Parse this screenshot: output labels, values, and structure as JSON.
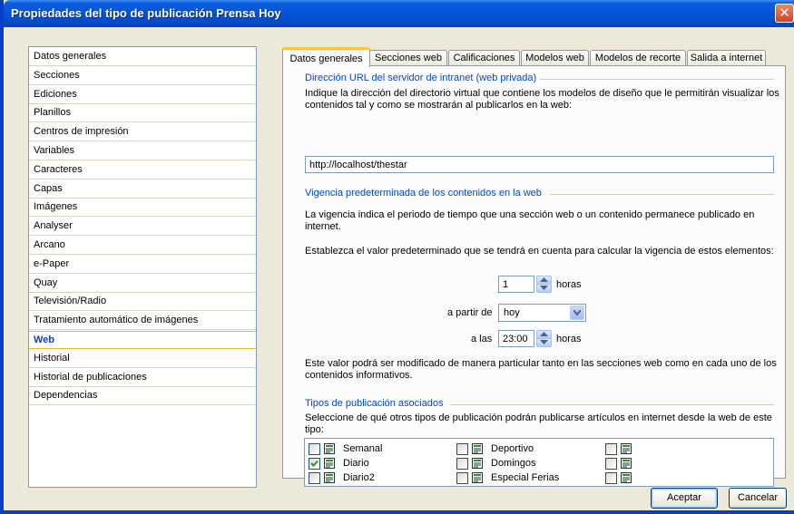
{
  "window": {
    "title": "Propiedades del tipo de publicación Prensa Hoy"
  },
  "icons": {
    "close": "close-icon",
    "spin_up": "arrow-up-icon",
    "spin_down": "arrow-down-icon",
    "dropdown": "chevron-down-icon",
    "checkmark": "checkmark-icon",
    "publication": "newspaper-icon"
  },
  "sidebar": {
    "items": [
      "Datos generales",
      "Secciones",
      "Ediciones",
      "Planillos",
      "Centros de impresión",
      "Variables",
      "Caracteres",
      "Capas",
      "Imágenes",
      "Analyser",
      "Arcano",
      "e-Paper",
      "Quay",
      "Televisión/Radio",
      "Tratamiento automático de imágenes",
      "Web",
      "Historial",
      "Historial de publicaciones",
      "Dependencias"
    ],
    "selected": "Web"
  },
  "tabs": [
    "Datos generales",
    "Secciones web",
    "Calificaciones",
    "Modelos web",
    "Modelos de recorte",
    "Salida a internet"
  ],
  "active_tab": "Datos generales",
  "url_group": {
    "title": "Dirección URL del servidor de intranet (web privada)",
    "description": "Indique la dirección del directorio virtual que contiene los modelos de diseño que le permitirán visualizar los contenidos tal y como se mostrarán al publicarlos en la web:",
    "url_value": "http://localhost/thestar"
  },
  "validity_group": {
    "title": "Vigencia predeterminada de los contenidos en la web",
    "description": "La vigencia indica el periodo de tiempo que una sección web o un contenido permanece publicado en internet.",
    "instruction": "Establezca el valor predeterminado que se tendrá en cuenta para calcular la vigencia de estos elementos:",
    "hours_value": "1",
    "hours_unit": "horas",
    "from_label": "a partir de",
    "from_value": "hoy",
    "at_label": "a las",
    "at_value": "23:00",
    "at_unit": "horas",
    "note": "Este valor podrá ser modificado de manera particular tanto en las secciones web como en cada uno de los contenidos informativos."
  },
  "types_group": {
    "title": "Tipos de publicación asociados",
    "description": "Seleccione de qué otros tipos de publicación podrán publicarse artículos en internet desde la web de este tipo:",
    "items": [
      {
        "label": "Semanal",
        "checked": false
      },
      {
        "label": "Diario",
        "checked": true
      },
      {
        "label": "Diario2",
        "checked": false
      },
      {
        "label": "Deportivo",
        "checked": false
      },
      {
        "label": "Domingos",
        "checked": false
      },
      {
        "label": "Especial Ferias",
        "checked": false
      },
      {
        "label": "",
        "checked": false
      },
      {
        "label": "",
        "checked": false
      },
      {
        "label": "",
        "checked": false
      }
    ]
  },
  "buttons": {
    "ok": "Aceptar",
    "cancel": "Cancelar"
  }
}
